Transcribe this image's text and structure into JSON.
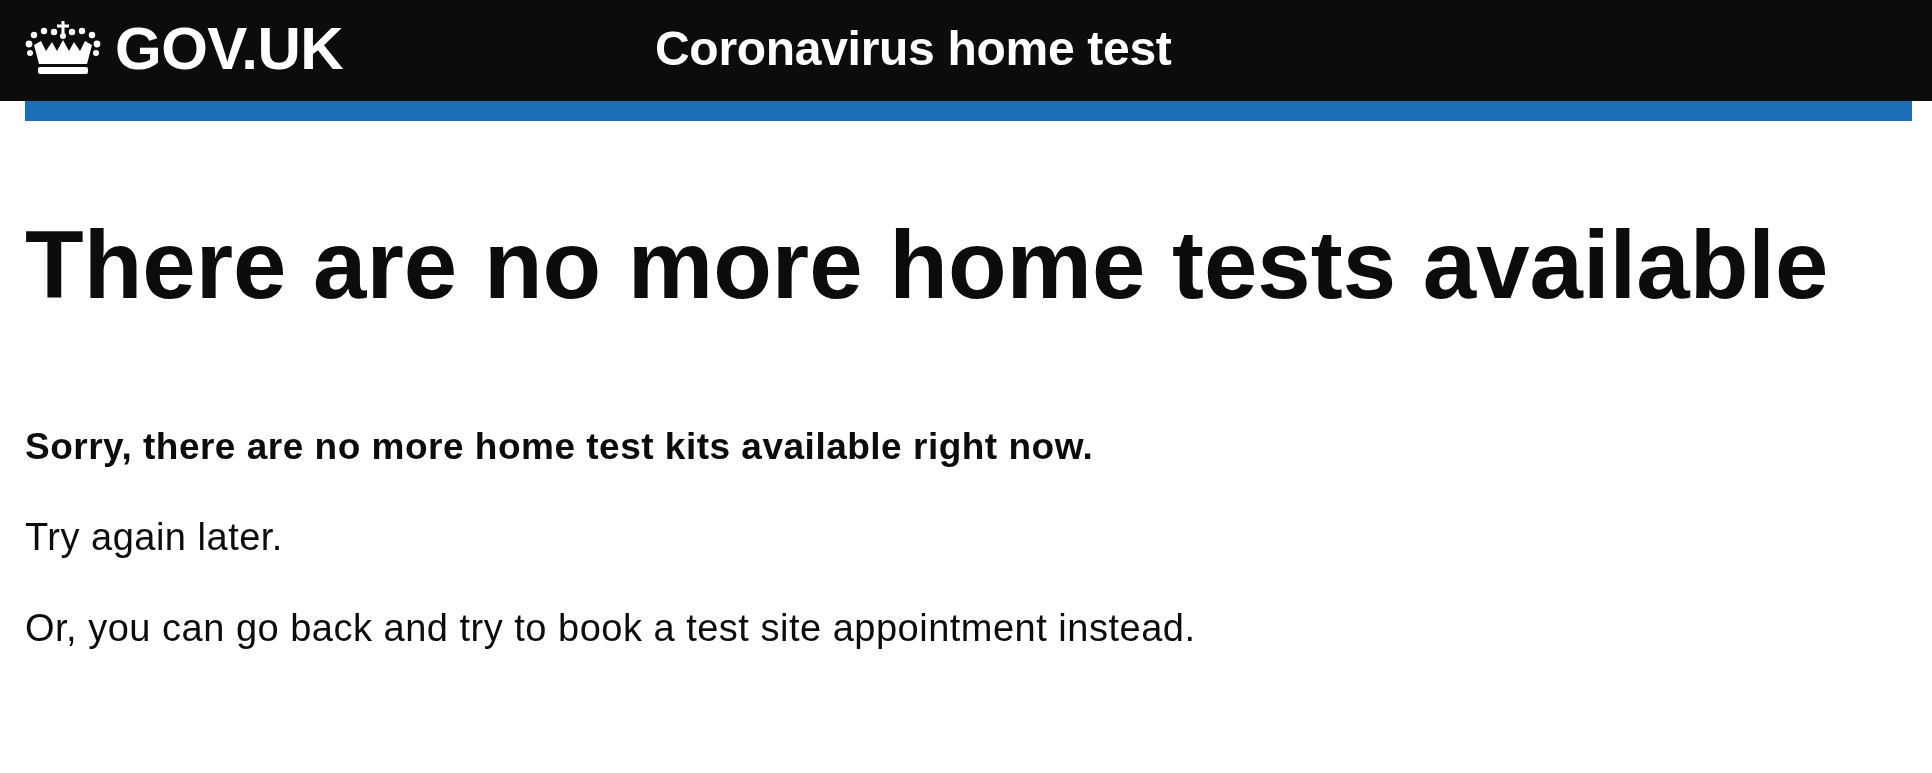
{
  "header": {
    "logo_text": "GOV.UK",
    "service_name": "Coronavirus home test"
  },
  "main": {
    "heading": "There are no more home tests available",
    "paragraphs": [
      {
        "kind": "lead",
        "text": "Sorry, there are no more home test kits available right now."
      },
      {
        "kind": "body",
        "text": "Try again later."
      },
      {
        "kind": "body",
        "text": "Or, you can go back and try to book a test site appointment instead."
      }
    ]
  }
}
